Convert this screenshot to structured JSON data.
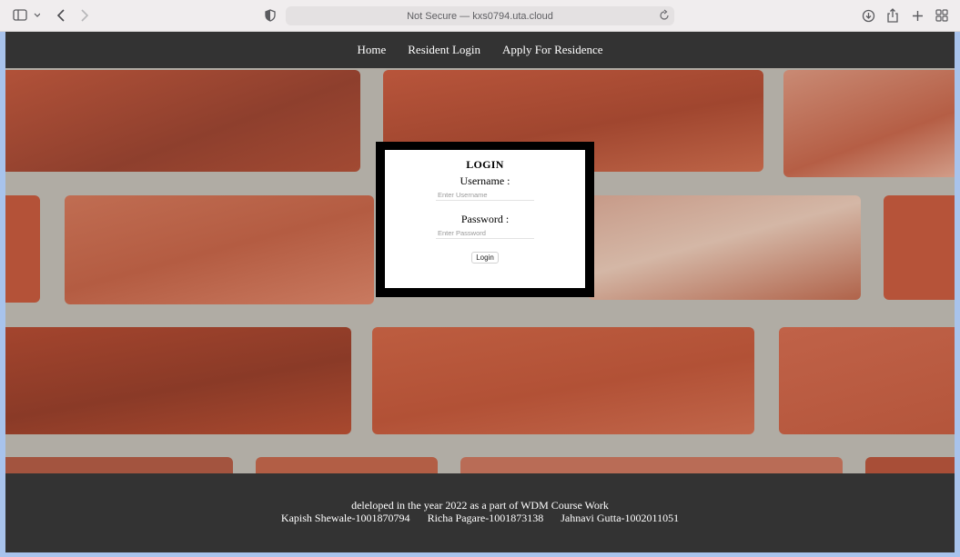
{
  "browser": {
    "address": "Not Secure — kxs0794.uta.cloud"
  },
  "nav": {
    "items": [
      "Home",
      "Resident Login",
      "Apply For Residence"
    ]
  },
  "login": {
    "title": "LOGIN",
    "username_label": "Username :",
    "username_placeholder": "Enter Username",
    "password_label": "Password :",
    "password_placeholder": "Enter Password",
    "button_label": "Login"
  },
  "footer": {
    "line1": "deleloped in the year 2022 as a part of WDM Course Work",
    "authors": [
      "Kapish Shewale-1001870794",
      "Richa Pagare-1001873138",
      "Jahnavi Gutta-1002011051"
    ]
  },
  "colors": {
    "nav_background": "#333333",
    "brick": "#b5553d",
    "mortar": "#b0aca4",
    "desktop": "#a8c3ec"
  }
}
